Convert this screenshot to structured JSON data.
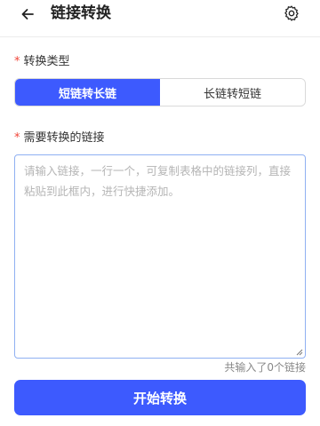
{
  "header": {
    "title": "链接转换",
    "back_icon": "arrow-left-icon",
    "settings_icon": "gear-icon"
  },
  "type_section": {
    "label": "转换类型",
    "required_mark": "*",
    "options": [
      "短链转长链",
      "长链转短链"
    ],
    "selected_index": 0
  },
  "links_section": {
    "label": "需要转换的链接",
    "required_mark": "*",
    "placeholder": "请输入链接，一行一个，可复制表格中的链接列，直接粘贴到此框内，进行快捷添加。",
    "value": "",
    "count_text": "共输入了0个链接"
  },
  "submit": {
    "label": "开始转换"
  },
  "colors": {
    "accent": "#3d5afe",
    "required": "#f04438",
    "input_border": "#8fb0f2"
  }
}
